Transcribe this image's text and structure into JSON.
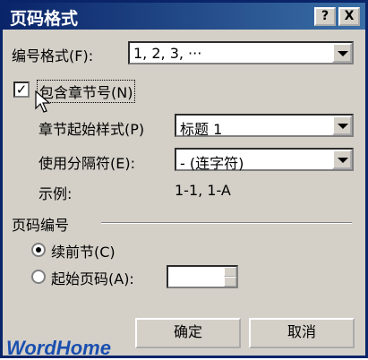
{
  "window": {
    "title": "页码格式",
    "help_btn": "?",
    "close_btn": "X"
  },
  "number_format": {
    "label": "编号格式(F):",
    "value": "1, 2, 3, ···"
  },
  "include_chapter": {
    "label": "包含章节号(N)",
    "checked": true
  },
  "chapter_style": {
    "label": "章节起始样式(P)",
    "value": "标题 1"
  },
  "separator": {
    "label": "使用分隔符(E):",
    "value": "-    (连字符)"
  },
  "example": {
    "label": "示例:",
    "value": "1-1, 1-A"
  },
  "page_numbering": {
    "group_label": "页码编号",
    "continue": {
      "label": "续前节(C)",
      "selected": true
    },
    "start_at": {
      "label": "起始页码(A):",
      "selected": false,
      "value": ""
    }
  },
  "buttons": {
    "ok": "确定",
    "cancel": "取消"
  },
  "watermark": "WordHome"
}
